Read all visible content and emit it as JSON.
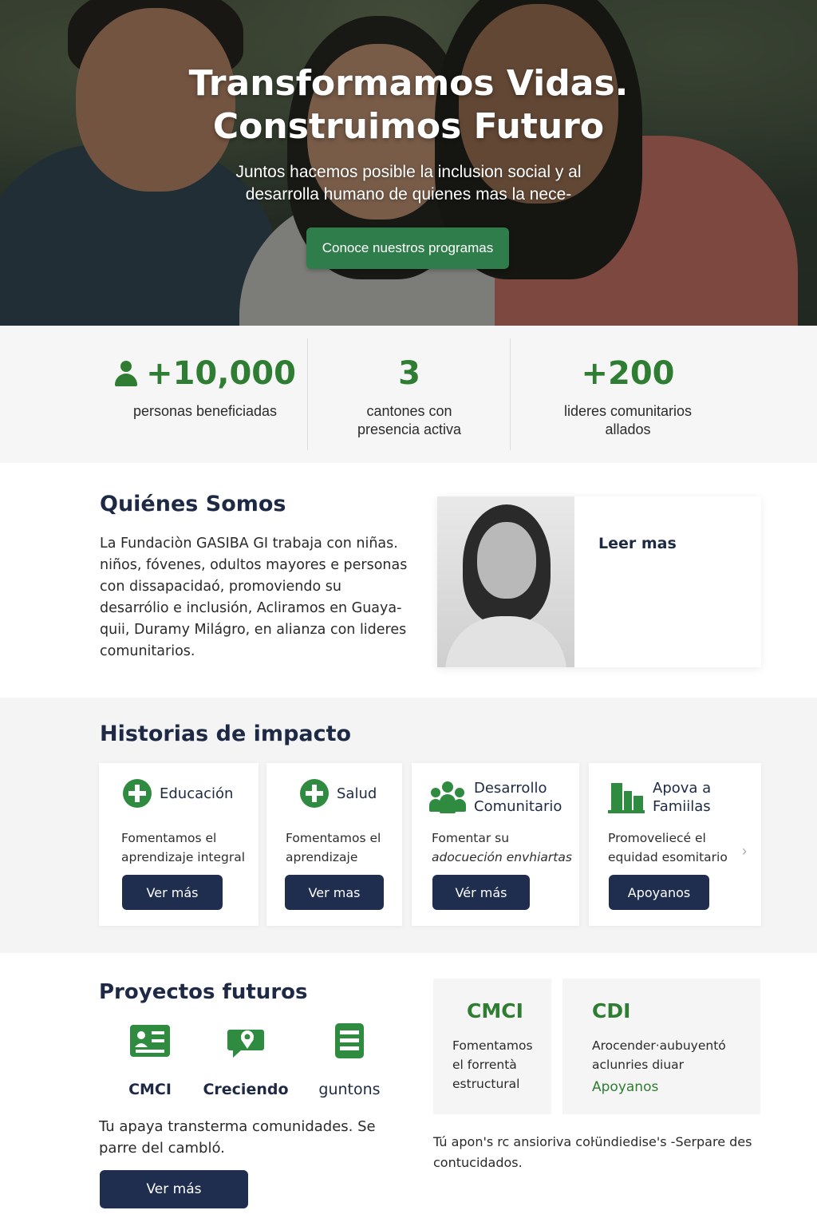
{
  "hero": {
    "title_line1": "Transformamos Vidas.",
    "title_line2": "Construimos Futuro",
    "subtitle_line1": "Juntos hacemos posible la inclusion social y al",
    "subtitle_line2": "desarrolla humano de quienes mas la nece-",
    "cta_label": "Conoce nuestros programas"
  },
  "stats": [
    {
      "value": "+10,000",
      "label_line1": "personas beneficiadas",
      "label_line2": "",
      "icon": "person-icon"
    },
    {
      "value": "3",
      "label_line1": "cantones con",
      "label_line2": "presencia activa"
    },
    {
      "value": "+200",
      "label_line1": "lideres comunitarios",
      "label_line2": "allados"
    }
  ],
  "about": {
    "title": "Quiénes Somos",
    "text_lines": [
      "La Fundaciòn GASIBA GI trabaja con niñas.",
      "niños, fóvenes, odultos mayores e personas",
      "con dissapacidaó, promoviendo su",
      "desarrólio e inclusión, Acliramos en Guaya-",
      "quii, Duramy Milágro, en alianza con lideres",
      "comunitarios."
    ],
    "read_more": "Leer mas"
  },
  "stories": {
    "title": "Historias de impacto",
    "cards": [
      {
        "title_line1": "Educación",
        "title_line2": "",
        "text_line1": "Fomentamos el",
        "text_line2": "aprendizaje integral",
        "button": "Ver más",
        "icon": "plus-circle-icon"
      },
      {
        "title_line1": "Salud",
        "title_line2": "",
        "text_line1": "Fomentamos el",
        "text_line2": "aprendizaje",
        "button": "Ver mas",
        "icon": "plus-circle-icon"
      },
      {
        "title_line1": "Desarrollo",
        "title_line2": "Comunitario",
        "text_line1": "Fomentar su",
        "text_line2": "adocueción envhiartas",
        "button": "Vér más",
        "icon": "group-icon"
      },
      {
        "title_line1": "Apova a",
        "title_line2": "Famiilas",
        "text_line1": "Promoveliecé el",
        "text_line2": "equidad esomitario",
        "button": "Apoyanos",
        "icon": "building-icon"
      }
    ]
  },
  "future": {
    "title": "Proyectos futuros",
    "items": [
      {
        "label": "CMCI",
        "icon": "id-card-icon"
      },
      {
        "label": "Creciendo",
        "icon": "map-pin-chat-icon"
      },
      {
        "label": "guntons",
        "icon": "list-icon"
      }
    ],
    "text_line1": "Tu apaya transterma comunidades. Se",
    "text_line2": "parre del cambló.",
    "button": "Ver más",
    "projects": [
      {
        "name": "CMCI",
        "desc_line1": "Fomentamos",
        "desc_line2": "el forrentà",
        "desc_line3": "estructural",
        "link": ""
      },
      {
        "name": "CDI",
        "desc_line1": "Arocender·aubuyentó",
        "desc_line2": "aclunries diuar",
        "desc_line3": "",
        "link": "Apoyanos"
      }
    ],
    "foot_line1": "Tú apon's rc ansioriva coŀündiedise's -Serpare des",
    "foot_line2": "contucidados."
  },
  "colors": {
    "brand_green": "#2e7d32",
    "cta_green": "#2e7d4a",
    "navy": "#1f2d4e",
    "heading_navy": "#1e2a45"
  }
}
